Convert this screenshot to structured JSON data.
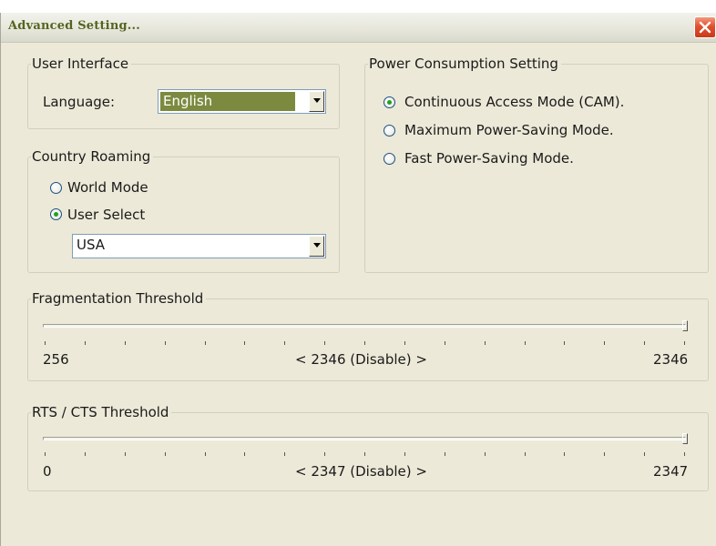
{
  "window": {
    "title": "Advanced Setting..."
  },
  "user_interface": {
    "legend": "User Interface",
    "language_label": "Language:",
    "language_value": "English"
  },
  "country_roaming": {
    "legend": "Country Roaming",
    "options": [
      "World Mode",
      "User Select"
    ],
    "selected": "User Select",
    "country_value": "USA"
  },
  "power": {
    "legend": "Power Consumption Setting",
    "options": [
      "Continuous Access Mode (CAM).",
      "Maximum Power-Saving Mode.",
      "Fast Power-Saving Mode."
    ],
    "selected": "Continuous Access Mode (CAM)."
  },
  "fragmentation": {
    "legend": "Fragmentation Threshold",
    "min": "256",
    "current": "< 2346 (Disable) >",
    "max": "2346",
    "value_fraction": 1.0
  },
  "rts_cts": {
    "legend": "RTS / CTS Threshold",
    "min": "0",
    "current": "< 2347 (Disable) >",
    "max": "2347",
    "value_fraction": 1.0
  },
  "colors": {
    "language_highlight": "#7b8a3f",
    "title_text": "#55641f",
    "close_button": "#e0512f"
  }
}
